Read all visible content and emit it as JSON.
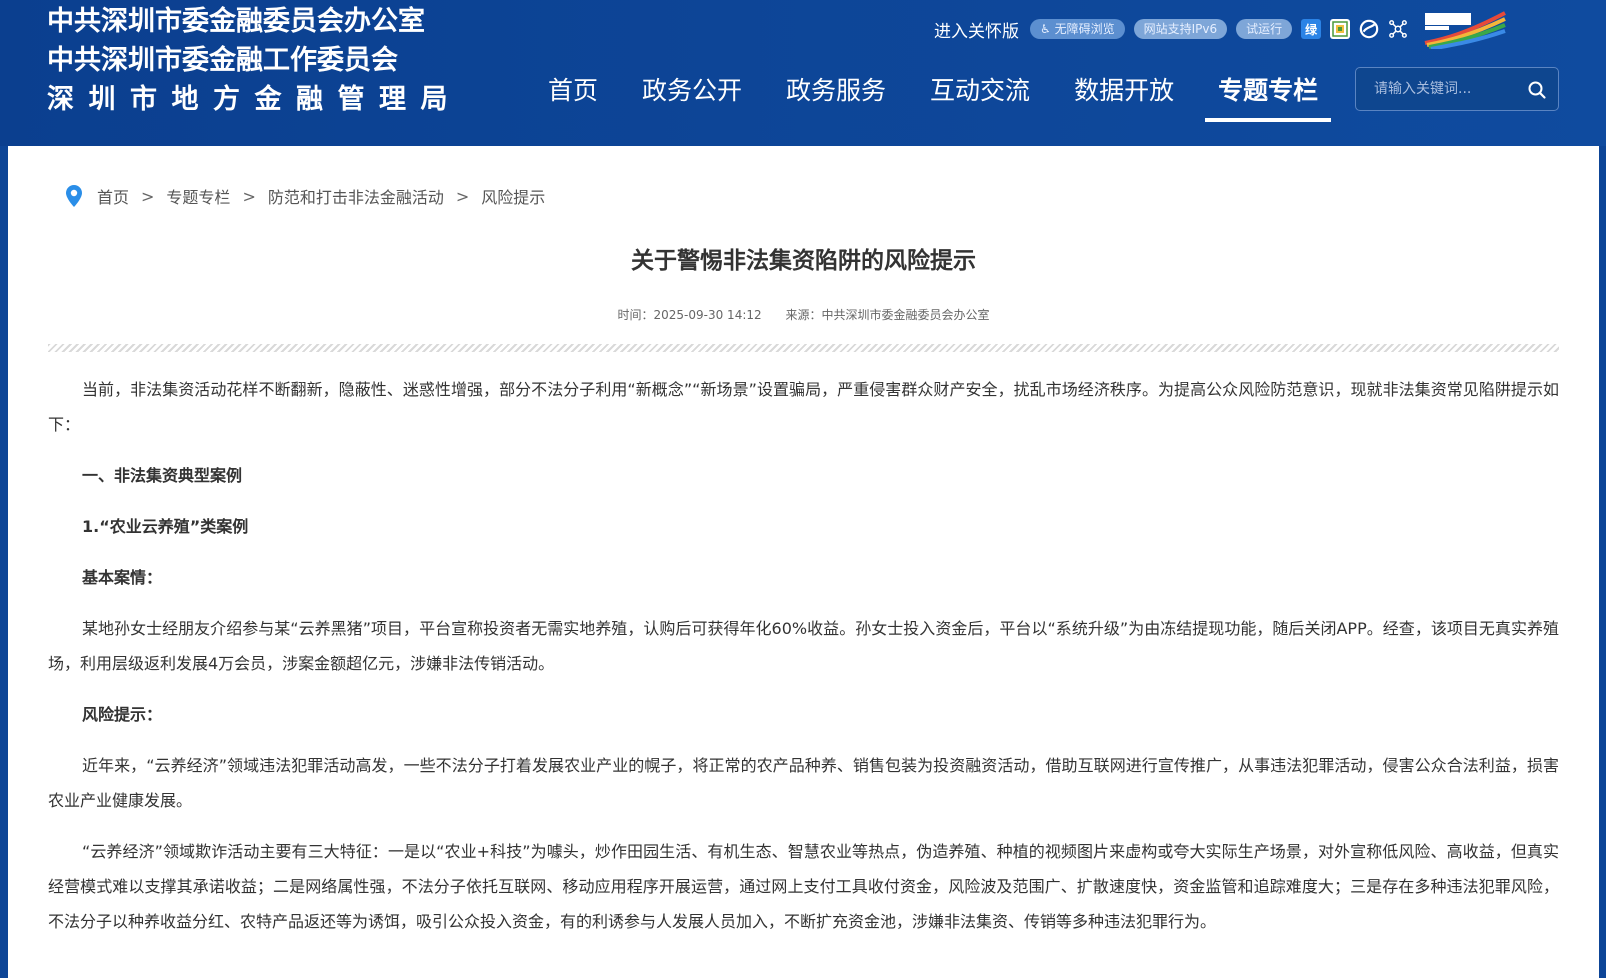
{
  "site": {
    "logo_lines": [
      "中共深圳市委金融委员会办公室",
      "中共深圳市委金融工作委员会",
      "深圳市地方金融管理局"
    ]
  },
  "topbar": {
    "care_version": "进入关怀版",
    "accessible": "无障碍浏览",
    "ipv6": "网站支持IPv6",
    "trial": "试运行",
    "green_icon_char": "绿"
  },
  "nav": {
    "items": [
      "首页",
      "政务公开",
      "政务服务",
      "互动交流",
      "数据开放",
      "专题专栏"
    ],
    "active_index": 5
  },
  "search": {
    "placeholder": "请输入关键词..."
  },
  "breadcrumb": {
    "items": [
      "首页",
      "专题专栏",
      "防范和打击非法金融活动",
      "风险提示"
    ],
    "separator": ">"
  },
  "article": {
    "title": "关于警惕非法集资陷阱的风险提示",
    "time": "时间：2025-09-30 14:12",
    "source": "来源：中共深圳市委金融委员会办公室",
    "paragraphs": [
      {
        "type": "text",
        "text": "当前，非法集资活动花样不断翻新，隐蔽性、迷惑性增强，部分不法分子利用“新概念”“新场景”设置骗局，严重侵害群众财产安全，扰乱市场经济秩序。为提高公众风险防范意识，现就非法集资常见陷阱提示如下："
      },
      {
        "type": "heading",
        "text": "一、非法集资典型案例"
      },
      {
        "type": "heading",
        "text": "1.“农业云养殖”类案例"
      },
      {
        "type": "heading",
        "text": "基本案情："
      },
      {
        "type": "text",
        "text": "某地孙女士经朋友介绍参与某“云养黑猪”项目，平台宣称投资者无需实地养殖，认购后可获得年化60%收益。孙女士投入资金后，平台以“系统升级”为由冻结提现功能，随后关闭APP。经查，该项目无真实养殖场，利用层级返利发展4万会员，涉案金额超亿元，涉嫌非法传销活动。"
      },
      {
        "type": "heading",
        "text": "风险提示："
      },
      {
        "type": "text",
        "text": "近年来，“云养经济”领域违法犯罪活动高发，一些不法分子打着发展农业产业的幌子，将正常的农产品种养、销售包装为投资融资活动，借助互联网进行宣传推广，从事违法犯罪活动，侵害公众合法利益，损害农业产业健康发展。"
      },
      {
        "type": "text",
        "text": "“云养经济”领域欺诈活动主要有三大特征：一是以“农业+科技”为噱头，炒作田园生活、有机生态、智慧农业等热点，伪造养殖、种植的视频图片来虚构或夸大实际生产场景，对外宣称低风险、高收益，但真实经营模式难以支撑其承诺收益；二是网络属性强，不法分子依托互联网、移动应用程序开展运营，通过网上支付工具收付资金，风险波及范围广、扩散速度快，资金监管和追踪难度大；三是存在多种违法犯罪风险，不法分子以种养收益分红、农特产品返还等为诱饵，吸引公众投入资金，有的利诱参与人发展人员加入，不断扩充资金池，涉嫌非法集资、传销等多种违法犯罪行为。"
      }
    ]
  },
  "colors": {
    "header_bg": "#0d4597",
    "text": "#333333",
    "pin": "#2a8ee8"
  }
}
